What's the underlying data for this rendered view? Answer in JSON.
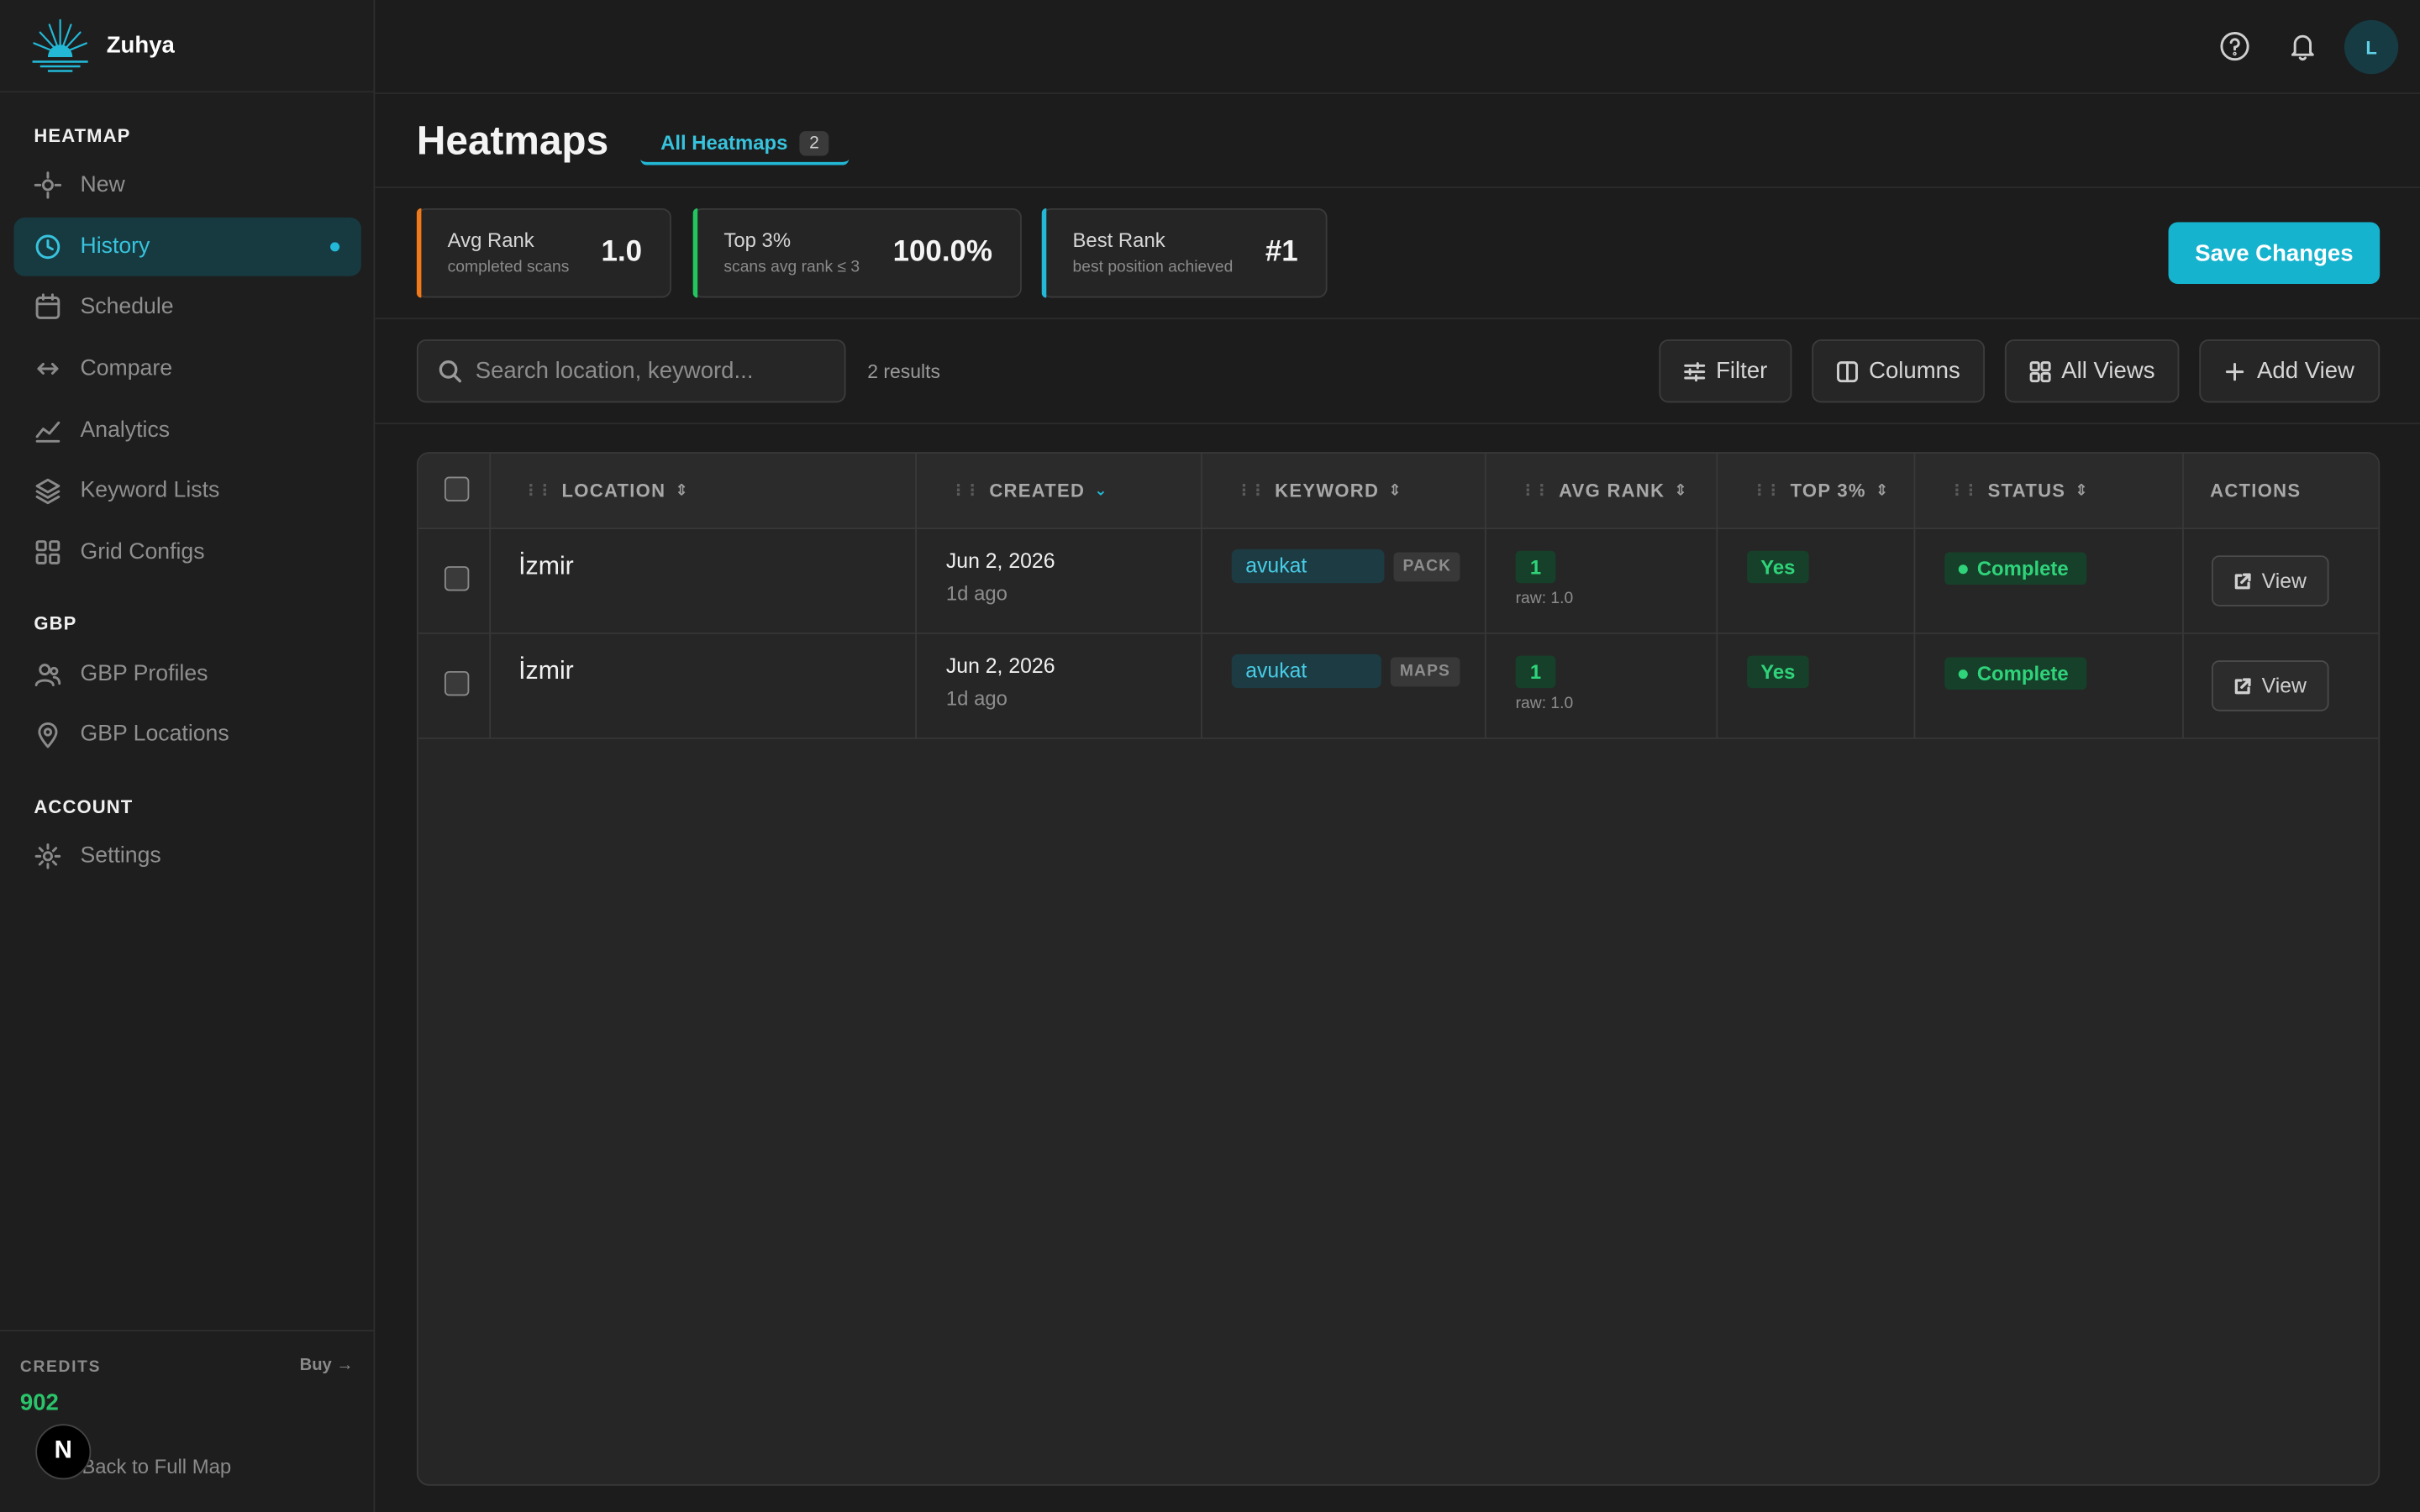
{
  "brand": {
    "name": "Zuhya"
  },
  "sidebar": {
    "sections": [
      {
        "title": "HEATMAP"
      },
      {
        "title": "GBP"
      },
      {
        "title": "ACCOUNT"
      }
    ],
    "items": [
      {
        "label": "New",
        "icon": "crosshair-icon"
      },
      {
        "label": "History",
        "icon": "clock-icon",
        "active": true
      },
      {
        "label": "Schedule",
        "icon": "calendar-icon"
      },
      {
        "label": "Compare",
        "icon": "arrows-horizontal-icon"
      },
      {
        "label": "Analytics",
        "icon": "line-chart-icon"
      },
      {
        "label": "Keyword Lists",
        "icon": "layers-icon"
      },
      {
        "label": "Grid Configs",
        "icon": "grid-icon"
      },
      {
        "label": "GBP Profiles",
        "icon": "users-icon"
      },
      {
        "label": "GBP Locations",
        "icon": "map-pin-icon"
      },
      {
        "label": "Settings",
        "icon": "gear-icon"
      }
    ],
    "credits": {
      "label": "CREDITS",
      "buy": "Buy →",
      "value": "902",
      "back": "Back to Full Map",
      "badge": "N"
    }
  },
  "topbar": {
    "avatar": "L"
  },
  "header": {
    "title": "Heatmaps",
    "tab": {
      "label": "All Heatmaps",
      "count": "2"
    }
  },
  "stats": [
    {
      "title": "Avg Rank",
      "subtitle": "completed scans",
      "value": "1.0",
      "accent": "#f07a1a"
    },
    {
      "title": "Top 3%",
      "subtitle": "scans avg rank ≤ 3",
      "value": "100.0%",
      "accent": "#22c55e"
    },
    {
      "title": "Best Rank",
      "subtitle": "best position achieved",
      "value": "#1",
      "accent": "#22b8d6"
    }
  ],
  "save_label": "Save Changes",
  "toolbar": {
    "search_placeholder": "Search location, keyword...",
    "results": "2 results",
    "filter": "Filter",
    "columns": "Columns",
    "all_views": "All Views",
    "add_view": "Add View"
  },
  "table": {
    "columns": [
      "LOCATION",
      "CREATED",
      "KEYWORD",
      "AVG RANK",
      "TOP 3%",
      "STATUS",
      "ACTIONS"
    ],
    "rows": [
      {
        "location": "İzmir",
        "date": "Jun 2, 2026",
        "ago": "1d ago",
        "keyword": "avukat",
        "type": "PACK",
        "rank": "1",
        "raw": "raw: 1.0",
        "top3": "Yes",
        "status": "Complete",
        "action": "View"
      },
      {
        "location": "İzmir",
        "date": "Jun 2, 2026",
        "ago": "1d ago",
        "keyword": "avukat",
        "type": "MAPS",
        "rank": "1",
        "raw": "raw: 1.0",
        "top3": "Yes",
        "status": "Complete",
        "action": "View"
      }
    ]
  },
  "colors": {
    "accent": "#22b8d6",
    "success": "#2fd37a",
    "background": "#1c1c1c"
  }
}
